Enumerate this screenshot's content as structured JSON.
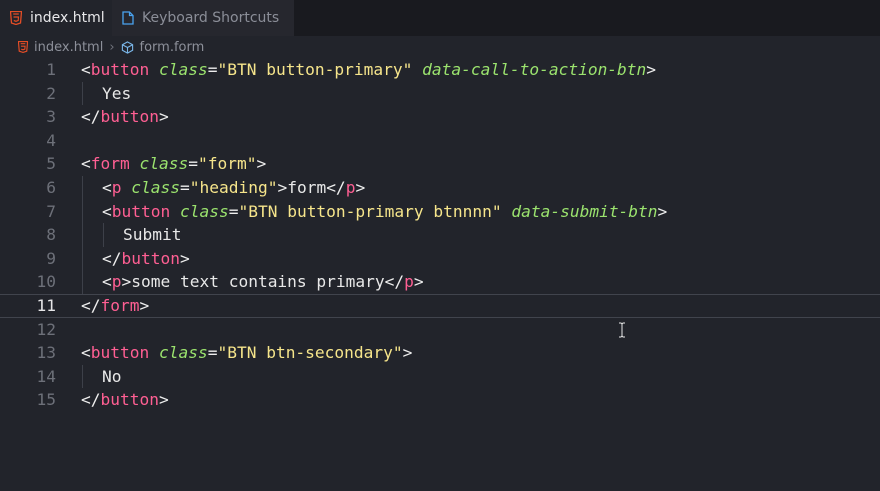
{
  "tabs": [
    {
      "label": "index.html",
      "active": true,
      "icon": "html5-icon"
    },
    {
      "label": "Keyboard Shortcuts",
      "active": false,
      "icon": "file-icon"
    }
  ],
  "breadcrumb": {
    "file": "index.html",
    "symbol": "form.form"
  },
  "editor": {
    "current_line": 11,
    "lines": [
      {
        "n": "1",
        "tokens": [
          [
            "t-punct",
            "<"
          ],
          [
            "t-tag",
            "button"
          ],
          [
            "t-text",
            " "
          ],
          [
            "t-attr",
            "class"
          ],
          [
            "t-punct",
            "="
          ],
          [
            "t-str",
            "\"BTN button-primary\""
          ],
          [
            "t-text",
            " "
          ],
          [
            "t-attr",
            "data-call-to-action-btn"
          ],
          [
            "t-punct",
            ">"
          ]
        ],
        "indent": 0
      },
      {
        "n": "2",
        "tokens": [
          [
            "t-text",
            "Yes"
          ]
        ],
        "indent": 1
      },
      {
        "n": "3",
        "tokens": [
          [
            "t-punct",
            "</"
          ],
          [
            "t-tag",
            "button"
          ],
          [
            "t-punct",
            ">"
          ]
        ],
        "indent": 0
      },
      {
        "n": "4",
        "tokens": [],
        "indent": 0
      },
      {
        "n": "5",
        "tokens": [
          [
            "t-punct",
            "<"
          ],
          [
            "t-tag",
            "form"
          ],
          [
            "t-text",
            " "
          ],
          [
            "t-attr",
            "class"
          ],
          [
            "t-punct",
            "="
          ],
          [
            "t-str",
            "\"form\""
          ],
          [
            "t-punct",
            ">"
          ]
        ],
        "indent": 0
      },
      {
        "n": "6",
        "tokens": [
          [
            "t-punct",
            "<"
          ],
          [
            "t-tag",
            "p"
          ],
          [
            "t-text",
            " "
          ],
          [
            "t-attr",
            "class"
          ],
          [
            "t-punct",
            "="
          ],
          [
            "t-str",
            "\"heading\""
          ],
          [
            "t-punct",
            ">"
          ],
          [
            "t-text",
            "form"
          ],
          [
            "t-punct",
            "</"
          ],
          [
            "t-tag",
            "p"
          ],
          [
            "t-punct",
            ">"
          ]
        ],
        "indent": 1
      },
      {
        "n": "7",
        "tokens": [
          [
            "t-punct",
            "<"
          ],
          [
            "t-tag",
            "button"
          ],
          [
            "t-text",
            " "
          ],
          [
            "t-attr",
            "class"
          ],
          [
            "t-punct",
            "="
          ],
          [
            "t-str",
            "\"BTN button-primary btnnnn\""
          ],
          [
            "t-text",
            " "
          ],
          [
            "t-attr",
            "data-submit-btn"
          ],
          [
            "t-punct",
            ">"
          ]
        ],
        "indent": 1
      },
      {
        "n": "8",
        "tokens": [
          [
            "t-text",
            "Submit"
          ]
        ],
        "indent": 2
      },
      {
        "n": "9",
        "tokens": [
          [
            "t-punct",
            "</"
          ],
          [
            "t-tag",
            "button"
          ],
          [
            "t-punct",
            ">"
          ]
        ],
        "indent": 1
      },
      {
        "n": "10",
        "tokens": [
          [
            "t-punct",
            "<"
          ],
          [
            "t-tag",
            "p"
          ],
          [
            "t-punct",
            ">"
          ],
          [
            "t-text",
            "some text contains primary"
          ],
          [
            "t-punct",
            "</"
          ],
          [
            "t-tag",
            "p"
          ],
          [
            "t-punct",
            ">"
          ]
        ],
        "indent": 1
      },
      {
        "n": "11",
        "tokens": [
          [
            "t-punct",
            "</"
          ],
          [
            "t-tag",
            "form"
          ],
          [
            "t-punct",
            ">"
          ]
        ],
        "indent": 0
      },
      {
        "n": "12",
        "tokens": [],
        "indent": 0
      },
      {
        "n": "13",
        "tokens": [
          [
            "t-punct",
            "<"
          ],
          [
            "t-tag",
            "button"
          ],
          [
            "t-text",
            " "
          ],
          [
            "t-attr",
            "class"
          ],
          [
            "t-punct",
            "="
          ],
          [
            "t-str",
            "\"BTN btn-secondary\""
          ],
          [
            "t-punct",
            ">"
          ]
        ],
        "indent": 0
      },
      {
        "n": "14",
        "tokens": [
          [
            "t-text",
            "No"
          ]
        ],
        "indent": 1
      },
      {
        "n": "15",
        "tokens": [
          [
            "t-punct",
            "</"
          ],
          [
            "t-tag",
            "button"
          ],
          [
            "t-punct",
            ">"
          ]
        ],
        "indent": 0
      }
    ]
  },
  "colors": {
    "background": "#22242b",
    "tag": "#ff5f93",
    "attribute": "#9be36e",
    "string": "#f6e58b",
    "html_icon": "#e44d26",
    "file_icon": "#4aa3f0"
  }
}
